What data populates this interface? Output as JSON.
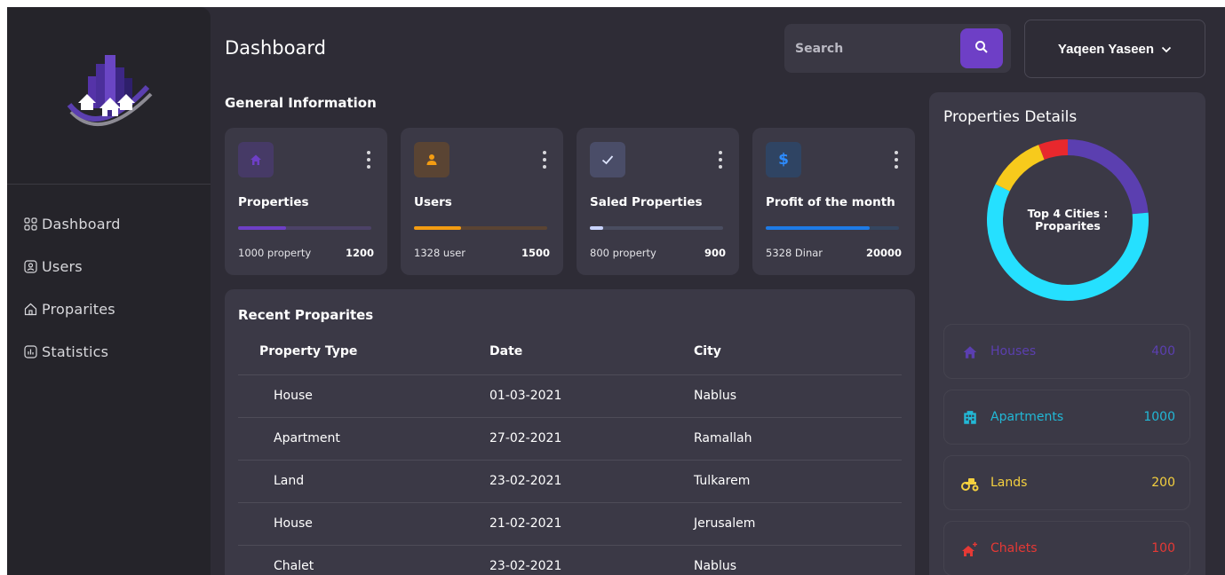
{
  "sidebar": {
    "items": [
      {
        "label": "Dashboard",
        "icon": "grid-icon"
      },
      {
        "label": "Users",
        "icon": "users-icon"
      },
      {
        "label": "Proparites",
        "icon": "home-icon"
      },
      {
        "label": "Statistics",
        "icon": "chart-icon"
      }
    ]
  },
  "header": {
    "title": "Dashboard",
    "search_placeholder": "Search",
    "user_name": "Yaqeen Yaseen"
  },
  "general": {
    "title": "General Information",
    "cards": [
      {
        "title": "Properties",
        "left_text": "1000 property",
        "right_text": "1200",
        "progress": 0.36,
        "icon": "house-icon",
        "accent": "#6e3fc6",
        "icon_bg": "#463a66",
        "track": "#4c4267"
      },
      {
        "title": "Users",
        "left_text": "1328 user",
        "right_text": "1500",
        "progress": 0.35,
        "icon": "person-icon",
        "accent": "#f39c12",
        "icon_bg": "#5a4433",
        "track": "#5a4433"
      },
      {
        "title": "Saled Properties",
        "left_text": "800 property",
        "right_text": "900",
        "progress": 0.1,
        "icon": "check-icon",
        "accent": "#c9d4ff",
        "icon_bg": "#4a4d68",
        "track": "#4a4d60"
      },
      {
        "title": "Profit of the month",
        "left_text": "5328 Dinar",
        "right_text": "20000",
        "progress": 0.78,
        "icon": "dollar-icon",
        "accent": "#1e7be6",
        "icon_bg": "#2f4463",
        "track": "#344660"
      }
    ]
  },
  "recent": {
    "title": "Recent Proparites",
    "columns": [
      "Property Type",
      "Date",
      "City"
    ],
    "rows": [
      [
        "House",
        "01-03-2021",
        "Nablus"
      ],
      [
        "Apartment",
        "27-02-2021",
        "Ramallah"
      ],
      [
        "Land",
        "23-02-2021",
        "Tulkarem"
      ],
      [
        "House",
        "21-02-2021",
        "Jerusalem"
      ],
      [
        "Chalet",
        "23-02-2021",
        "Nablus"
      ]
    ]
  },
  "details": {
    "title": "Properties Details",
    "donut_label_line1": "Top 4 Cities :",
    "donut_label_line2": "Proparites",
    "items": [
      {
        "label": "Houses",
        "value": "400",
        "color": "#5b3fb0",
        "icon": "house-icon"
      },
      {
        "label": "Apartments",
        "value": "1000",
        "color": "#22b8d6",
        "icon": "building-icon"
      },
      {
        "label": "Lands",
        "value": "200",
        "color": "#f4d03f",
        "icon": "tractor-icon"
      },
      {
        "label": "Chalets",
        "value": "100",
        "color": "#e53935",
        "icon": "chalet-icon"
      }
    ]
  },
  "chart_data": {
    "type": "pie",
    "categories": [
      "Houses",
      "Apartments",
      "Lands",
      "Chalets"
    ],
    "values": [
      400,
      1000,
      200,
      100
    ],
    "colors": [
      "#5b3fb0",
      "#25e0ff",
      "#f7ca1c",
      "#e8282d"
    ],
    "title": "Top 4 Cities : Proparites"
  }
}
